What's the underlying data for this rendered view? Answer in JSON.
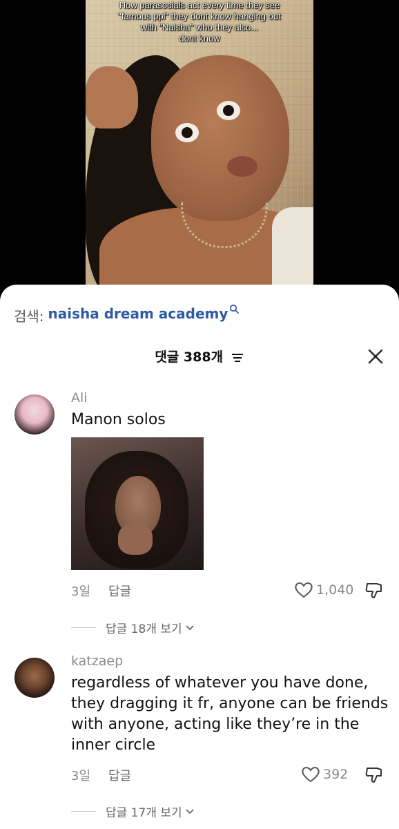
{
  "video": {
    "caption_lines": [
      "How parasocials act every time they see",
      "\"famous ppl\" they dont know hanging out",
      "with \"Naisha\" who they also...",
      "dont know"
    ]
  },
  "search": {
    "prefix": "검색:",
    "query": "naisha dream academy"
  },
  "comments_header": {
    "title": "댓글 388개"
  },
  "comments": [
    {
      "username": "Ali",
      "text": "Manon solos",
      "age": "3일",
      "reply_label": "답글",
      "likes": "1,040",
      "view_replies": "답글 18개 보기"
    },
    {
      "username": "katzaep",
      "text": "regardless of whatever you have done, they dragging it fr, anyone can be friends with anyone, acting like they’re in the inner circle",
      "age": "3일",
      "reply_label": "답글",
      "likes": "392",
      "view_replies": "답글 17개 보기"
    }
  ],
  "icons": {
    "search": "search-icon",
    "filter": "filter-icon",
    "close": "close-icon",
    "like": "heart-icon",
    "dislike": "thumbs-down-icon",
    "expand": "chevron-down-icon"
  },
  "colors": {
    "search_query": "#2e5aa6",
    "sheet_bg": "#ffffff",
    "muted_text": "#888888"
  }
}
